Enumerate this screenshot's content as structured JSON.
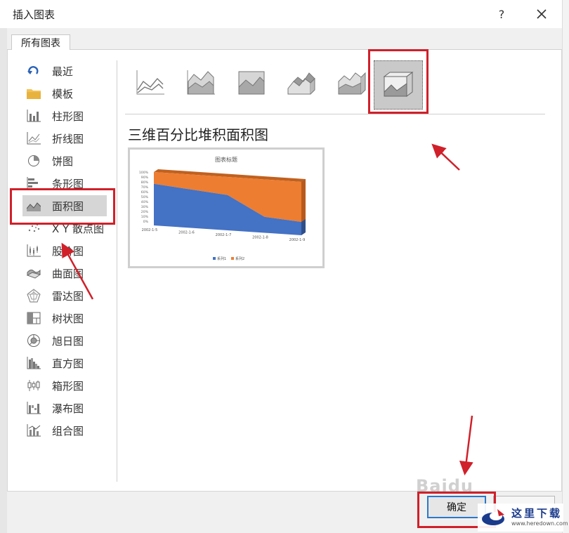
{
  "dialog": {
    "title": "插入图表",
    "help_label": "?",
    "tab_all_charts": "所有图表",
    "ok_label": "确定"
  },
  "sidebar": {
    "items": [
      {
        "label": "最近",
        "icon": "recent-icon"
      },
      {
        "label": "模板",
        "icon": "folder-icon"
      },
      {
        "label": "柱形图",
        "icon": "column-chart-icon"
      },
      {
        "label": "折线图",
        "icon": "line-chart-icon"
      },
      {
        "label": "饼图",
        "icon": "pie-chart-icon"
      },
      {
        "label": "条形图",
        "icon": "bar-chart-icon"
      },
      {
        "label": "面积图",
        "icon": "area-chart-icon",
        "selected": true
      },
      {
        "label": "X Y 散点图",
        "icon": "scatter-chart-icon"
      },
      {
        "label": "股价图",
        "icon": "stock-chart-icon"
      },
      {
        "label": "曲面图",
        "icon": "surface-chart-icon"
      },
      {
        "label": "雷达图",
        "icon": "radar-chart-icon"
      },
      {
        "label": "树状图",
        "icon": "treemap-chart-icon"
      },
      {
        "label": "旭日图",
        "icon": "sunburst-chart-icon"
      },
      {
        "label": "直方图",
        "icon": "histogram-chart-icon"
      },
      {
        "label": "箱形图",
        "icon": "box-whisker-chart-icon"
      },
      {
        "label": "瀑布图",
        "icon": "waterfall-chart-icon"
      },
      {
        "label": "组合图",
        "icon": "combo-chart-icon"
      }
    ]
  },
  "subtypes": {
    "selected_index": 5,
    "items": [
      {
        "icon": "area-icon"
      },
      {
        "icon": "stacked-area-icon"
      },
      {
        "icon": "percent-stacked-area-icon"
      },
      {
        "icon": "3d-area-icon"
      },
      {
        "icon": "3d-stacked-area-icon"
      },
      {
        "icon": "3d-percent-stacked-area-icon"
      }
    ]
  },
  "selected_chart_name": "三维百分比堆积面积图",
  "chart_data": {
    "type": "area",
    "title": "图表标题",
    "categories": [
      "2002-1-5",
      "2002-1-6",
      "2002-1-7",
      "2002-1-8",
      "2002-1-9"
    ],
    "series": [
      {
        "name": "系列1",
        "color": "#4472c4",
        "values": [
          78,
          72,
          66,
          30,
          25
        ]
      },
      {
        "name": "系列2",
        "color": "#ed7d31",
        "values": [
          22,
          28,
          34,
          70,
          75
        ]
      }
    ],
    "y_ticks": [
      "0%",
      "10%",
      "20%",
      "30%",
      "40%",
      "50%",
      "60%",
      "70%",
      "80%",
      "90%",
      "100%"
    ],
    "ylim": [
      0,
      100
    ],
    "legend": "bottom"
  },
  "watermarks": {
    "baidu": "Baidu",
    "site_cn": "这里下载",
    "site_url": "www.heredown.com"
  },
  "colors": {
    "highlight": "#d0202a",
    "accent": "#2a78c9"
  }
}
